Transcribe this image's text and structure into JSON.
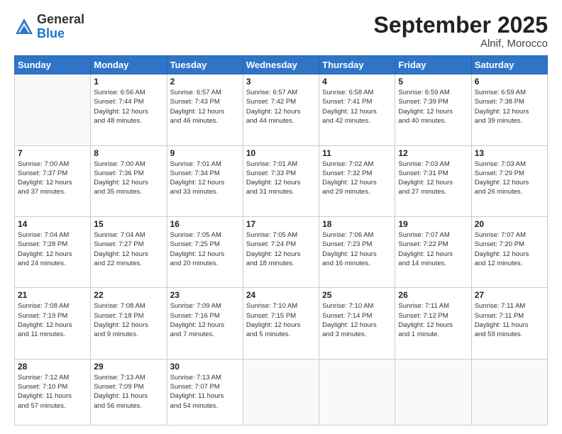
{
  "header": {
    "logo_general": "General",
    "logo_blue": "Blue",
    "month_title": "September 2025",
    "location": "Alnif, Morocco"
  },
  "days_of_week": [
    "Sunday",
    "Monday",
    "Tuesday",
    "Wednesday",
    "Thursday",
    "Friday",
    "Saturday"
  ],
  "weeks": [
    [
      {
        "day": "",
        "info": ""
      },
      {
        "day": "1",
        "info": "Sunrise: 6:56 AM\nSunset: 7:44 PM\nDaylight: 12 hours\nand 48 minutes."
      },
      {
        "day": "2",
        "info": "Sunrise: 6:57 AM\nSunset: 7:43 PM\nDaylight: 12 hours\nand 46 minutes."
      },
      {
        "day": "3",
        "info": "Sunrise: 6:57 AM\nSunset: 7:42 PM\nDaylight: 12 hours\nand 44 minutes."
      },
      {
        "day": "4",
        "info": "Sunrise: 6:58 AM\nSunset: 7:41 PM\nDaylight: 12 hours\nand 42 minutes."
      },
      {
        "day": "5",
        "info": "Sunrise: 6:59 AM\nSunset: 7:39 PM\nDaylight: 12 hours\nand 40 minutes."
      },
      {
        "day": "6",
        "info": "Sunrise: 6:59 AM\nSunset: 7:38 PM\nDaylight: 12 hours\nand 39 minutes."
      }
    ],
    [
      {
        "day": "7",
        "info": "Sunrise: 7:00 AM\nSunset: 7:37 PM\nDaylight: 12 hours\nand 37 minutes."
      },
      {
        "day": "8",
        "info": "Sunrise: 7:00 AM\nSunset: 7:36 PM\nDaylight: 12 hours\nand 35 minutes."
      },
      {
        "day": "9",
        "info": "Sunrise: 7:01 AM\nSunset: 7:34 PM\nDaylight: 12 hours\nand 33 minutes."
      },
      {
        "day": "10",
        "info": "Sunrise: 7:01 AM\nSunset: 7:33 PM\nDaylight: 12 hours\nand 31 minutes."
      },
      {
        "day": "11",
        "info": "Sunrise: 7:02 AM\nSunset: 7:32 PM\nDaylight: 12 hours\nand 29 minutes."
      },
      {
        "day": "12",
        "info": "Sunrise: 7:03 AM\nSunset: 7:31 PM\nDaylight: 12 hours\nand 27 minutes."
      },
      {
        "day": "13",
        "info": "Sunrise: 7:03 AM\nSunset: 7:29 PM\nDaylight: 12 hours\nand 26 minutes."
      }
    ],
    [
      {
        "day": "14",
        "info": "Sunrise: 7:04 AM\nSunset: 7:28 PM\nDaylight: 12 hours\nand 24 minutes."
      },
      {
        "day": "15",
        "info": "Sunrise: 7:04 AM\nSunset: 7:27 PM\nDaylight: 12 hours\nand 22 minutes."
      },
      {
        "day": "16",
        "info": "Sunrise: 7:05 AM\nSunset: 7:25 PM\nDaylight: 12 hours\nand 20 minutes."
      },
      {
        "day": "17",
        "info": "Sunrise: 7:05 AM\nSunset: 7:24 PM\nDaylight: 12 hours\nand 18 minutes."
      },
      {
        "day": "18",
        "info": "Sunrise: 7:06 AM\nSunset: 7:23 PM\nDaylight: 12 hours\nand 16 minutes."
      },
      {
        "day": "19",
        "info": "Sunrise: 7:07 AM\nSunset: 7:22 PM\nDaylight: 12 hours\nand 14 minutes."
      },
      {
        "day": "20",
        "info": "Sunrise: 7:07 AM\nSunset: 7:20 PM\nDaylight: 12 hours\nand 12 minutes."
      }
    ],
    [
      {
        "day": "21",
        "info": "Sunrise: 7:08 AM\nSunset: 7:19 PM\nDaylight: 12 hours\nand 11 minutes."
      },
      {
        "day": "22",
        "info": "Sunrise: 7:08 AM\nSunset: 7:18 PM\nDaylight: 12 hours\nand 9 minutes."
      },
      {
        "day": "23",
        "info": "Sunrise: 7:09 AM\nSunset: 7:16 PM\nDaylight: 12 hours\nand 7 minutes."
      },
      {
        "day": "24",
        "info": "Sunrise: 7:10 AM\nSunset: 7:15 PM\nDaylight: 12 hours\nand 5 minutes."
      },
      {
        "day": "25",
        "info": "Sunrise: 7:10 AM\nSunset: 7:14 PM\nDaylight: 12 hours\nand 3 minutes."
      },
      {
        "day": "26",
        "info": "Sunrise: 7:11 AM\nSunset: 7:12 PM\nDaylight: 12 hours\nand 1 minute."
      },
      {
        "day": "27",
        "info": "Sunrise: 7:11 AM\nSunset: 7:11 PM\nDaylight: 11 hours\nand 59 minutes."
      }
    ],
    [
      {
        "day": "28",
        "info": "Sunrise: 7:12 AM\nSunset: 7:10 PM\nDaylight: 11 hours\nand 57 minutes."
      },
      {
        "day": "29",
        "info": "Sunrise: 7:13 AM\nSunset: 7:09 PM\nDaylight: 11 hours\nand 56 minutes."
      },
      {
        "day": "30",
        "info": "Sunrise: 7:13 AM\nSunset: 7:07 PM\nDaylight: 11 hours\nand 54 minutes."
      },
      {
        "day": "",
        "info": ""
      },
      {
        "day": "",
        "info": ""
      },
      {
        "day": "",
        "info": ""
      },
      {
        "day": "",
        "info": ""
      }
    ]
  ]
}
